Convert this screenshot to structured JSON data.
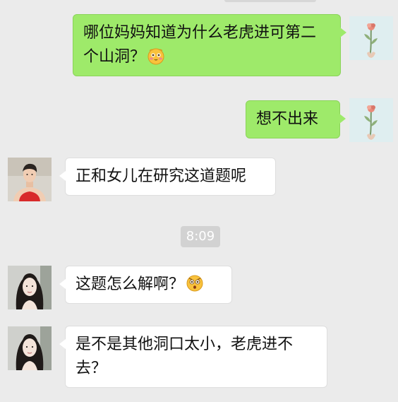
{
  "messages": [
    {
      "sender": "me",
      "text": "哪位妈妈知道为什么老虎进可第二个山洞？",
      "emoji": "blush-face-emoji",
      "avatar": "flower-avatar"
    },
    {
      "sender": "me",
      "text": "想不出来",
      "avatar": "flower-avatar"
    },
    {
      "sender": "other",
      "text": "正和女儿在研究这道题呢",
      "avatar": "young-man-avatar"
    },
    {
      "sender": "other",
      "text": "这题怎么解啊？",
      "emoji": "surprised-face-emoji",
      "avatar": "woman-avatar"
    },
    {
      "sender": "other",
      "text": "是不是其他洞口太小，老虎进不去？",
      "avatar": "woman-avatar"
    }
  ],
  "timestamp": "8:09",
  "colors": {
    "background": "#ebebeb",
    "my_bubble": "#9eea6a",
    "other_bubble": "#ffffff",
    "timestamp_bg": "#d2d2d2"
  }
}
